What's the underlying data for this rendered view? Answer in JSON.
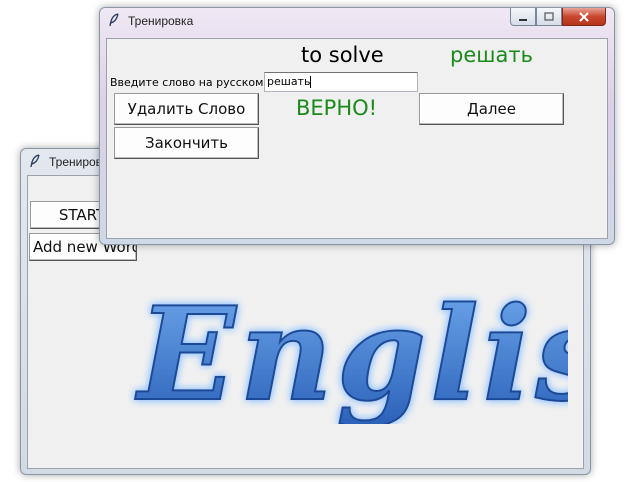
{
  "back_window": {
    "title": "Тренировка",
    "start_label": "START",
    "add_word_label": "Add new Word",
    "logo_text": "English"
  },
  "front_window": {
    "title": "Тренировка",
    "word_english": "to solve",
    "word_translation": "решать",
    "prompt_label": "Введите слово на русском:",
    "answer_value": "решать",
    "delete_label": "Удалить Слово",
    "result_text": "ВЕРНО!",
    "next_label": "Далее",
    "finish_label": "Закончить"
  },
  "colors": {
    "correct_green": "#1a8a1a",
    "logo_blue": "#3f7bd0"
  }
}
